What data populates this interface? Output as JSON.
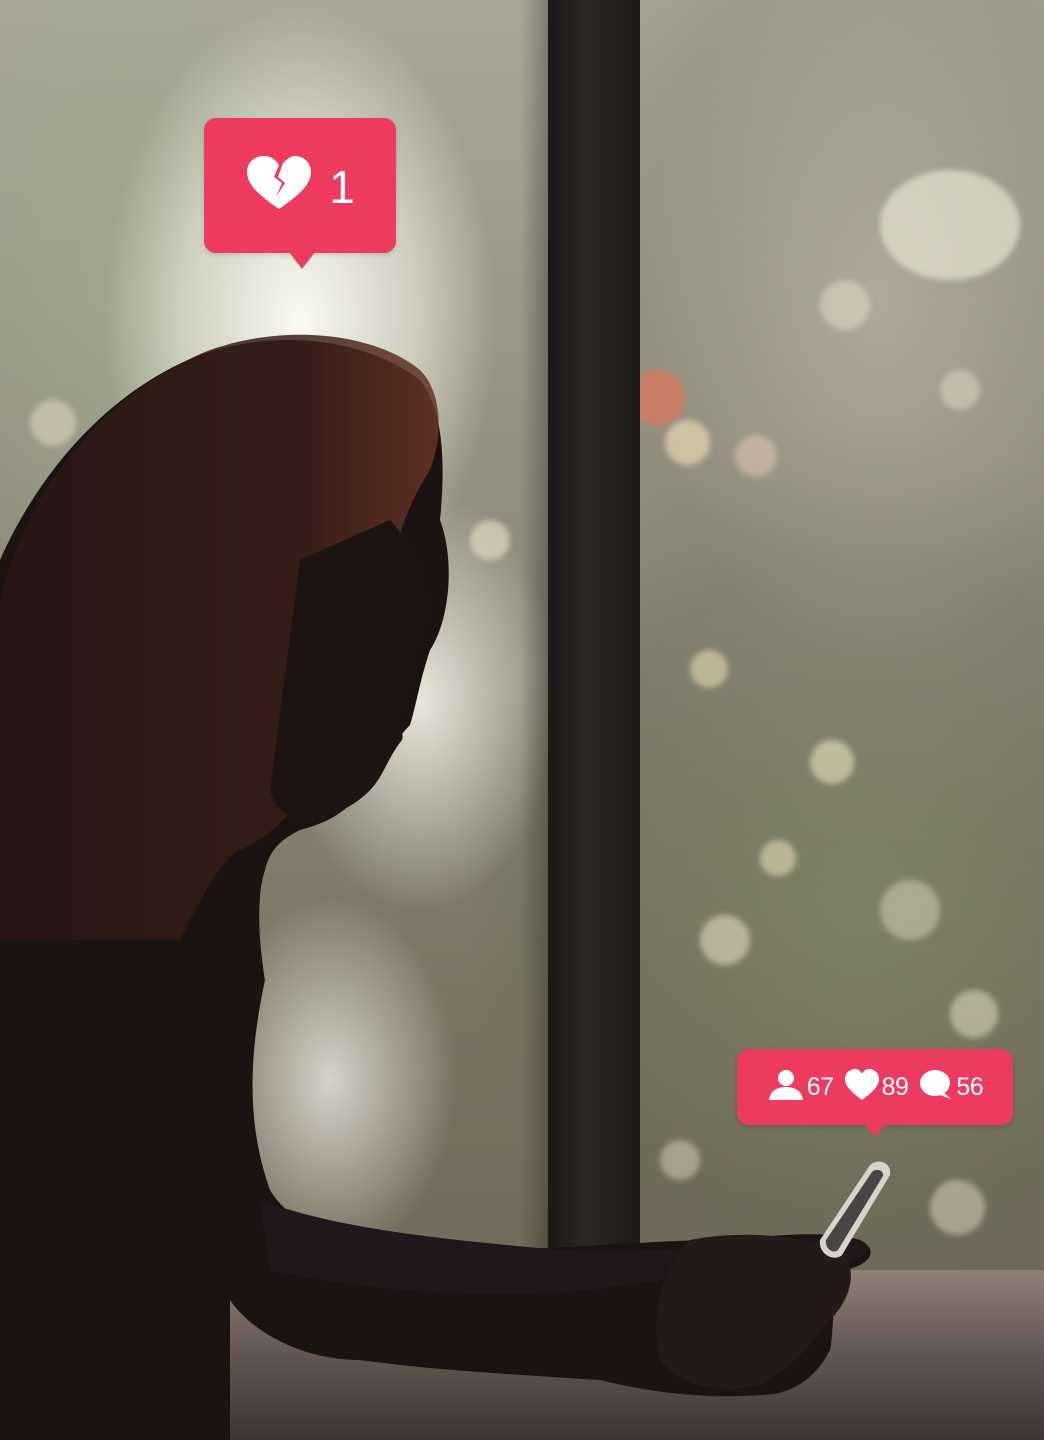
{
  "notifications": {
    "dislike": {
      "icon": "broken-heart-icon",
      "count": "1"
    },
    "activity": {
      "followers": {
        "icon": "person-icon",
        "count": "67"
      },
      "likes": {
        "icon": "heart-icon",
        "count": "89"
      },
      "comments": {
        "icon": "comment-icon",
        "count": "56"
      }
    }
  },
  "colors": {
    "notification_bg": "#ed3b5f",
    "notification_fg": "#ffffff"
  }
}
